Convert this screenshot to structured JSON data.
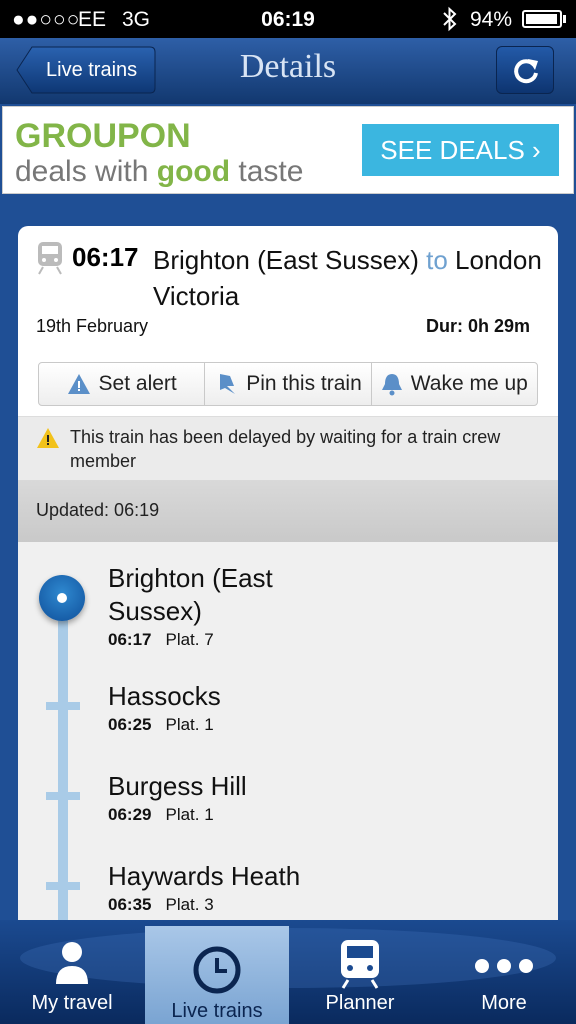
{
  "status_bar": {
    "signal": "●●○○○",
    "carrier": "EE",
    "network": "3G",
    "time": "06:19",
    "battery": "94%"
  },
  "nav": {
    "back_label": "Live trains",
    "title": "Details"
  },
  "ad": {
    "brand": "GROUPON",
    "tagline_prefix": "deals with ",
    "tagline_highlight": "good",
    "tagline_suffix": " taste",
    "cta": "SEE DEALS ›"
  },
  "journey": {
    "departure_time": "06:17",
    "origin": "Brighton (East Sussex)",
    "connector": "to",
    "destination": "London Victoria",
    "date": "19th February",
    "duration": "Dur: 0h 29m"
  },
  "actions": {
    "alert": "Set alert",
    "pin": "Pin this train",
    "wake": "Wake me up"
  },
  "warning": "This train has been delayed by waiting for a train crew member",
  "updated": "Updated: 06:19",
  "stops": [
    {
      "name": "Brighton (East Sussex)",
      "time": "06:17",
      "platform": "Plat. 7"
    },
    {
      "name": "Hassocks",
      "time": "06:25",
      "platform": "Plat. 1"
    },
    {
      "name": "Burgess Hill",
      "time": "06:29",
      "platform": "Plat. 1"
    },
    {
      "name": "Haywards Heath",
      "time": "06:35",
      "platform": "Plat. 3"
    }
  ],
  "tabs": [
    {
      "label": "My travel",
      "icon": "person-icon"
    },
    {
      "label": "Live trains",
      "icon": "clock-icon"
    },
    {
      "label": "Planner",
      "icon": "train-icon"
    },
    {
      "label": "More",
      "icon": "ellipsis-icon"
    }
  ],
  "colors": {
    "nav_blue": "#1f4f95",
    "groupon_green": "#82b548",
    "deals_blue": "#3bb6e0",
    "route_line": "#a9cbe7"
  }
}
